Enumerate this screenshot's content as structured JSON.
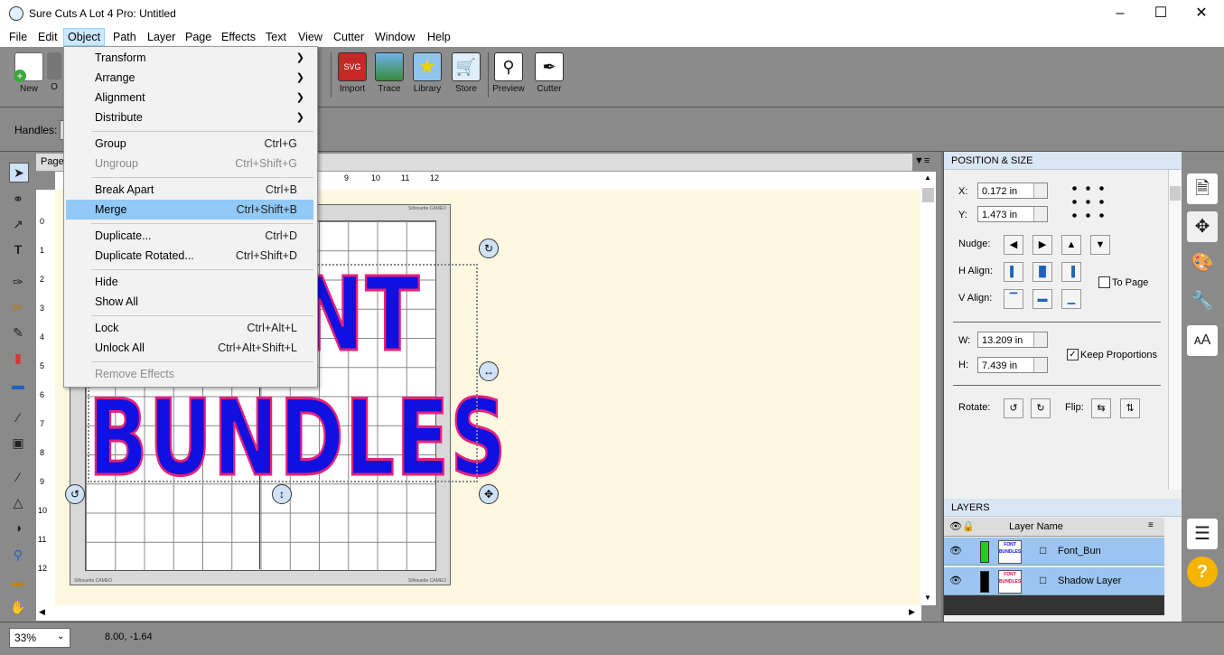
{
  "title": "Sure Cuts A Lot 4 Pro: Untitled",
  "menubar": [
    "File",
    "Edit",
    "Object",
    "Path",
    "Layer",
    "Page",
    "Effects",
    "Text",
    "View",
    "Cutter",
    "Window",
    "Help"
  ],
  "toolbar": {
    "new": "New",
    "import": "Import",
    "trace": "Trace",
    "library": "Library",
    "store": "Store",
    "preview": "Preview",
    "cutter": "Cutter",
    "partial": "O"
  },
  "handles_label": "Handles:",
  "page_tab": "Page",
  "ruler_top": [
    "9",
    "10",
    "11",
    "12"
  ],
  "ruler_left": [
    "0",
    "1",
    "2",
    "3",
    "4",
    "5",
    "6",
    "7",
    "8",
    "9",
    "10",
    "11",
    "12"
  ],
  "canvas_text": {
    "line1": "NT",
    "line2": "BUNDLES"
  },
  "object_menu": [
    {
      "label": "Transform",
      "shortcut": "",
      "submenu": true,
      "disabled": false
    },
    {
      "label": "Arrange",
      "shortcut": "",
      "submenu": true,
      "disabled": false
    },
    {
      "label": "Alignment",
      "shortcut": "",
      "submenu": true,
      "disabled": false
    },
    {
      "label": "Distribute",
      "shortcut": "",
      "submenu": true,
      "disabled": false
    },
    {
      "label": "Group",
      "shortcut": "Ctrl+G",
      "submenu": false,
      "disabled": false
    },
    {
      "label": "Ungroup",
      "shortcut": "Ctrl+Shift+G",
      "submenu": false,
      "disabled": true
    },
    {
      "label": "Break Apart",
      "shortcut": "Ctrl+B",
      "submenu": false,
      "disabled": false
    },
    {
      "label": "Merge",
      "shortcut": "Ctrl+Shift+B",
      "submenu": false,
      "disabled": false,
      "highlighted": true
    },
    {
      "label": "Duplicate...",
      "shortcut": "Ctrl+D",
      "submenu": false,
      "disabled": false
    },
    {
      "label": "Duplicate Rotated...",
      "shortcut": "Ctrl+Shift+D",
      "submenu": false,
      "disabled": false
    },
    {
      "label": "Hide",
      "shortcut": "",
      "submenu": false,
      "disabled": false
    },
    {
      "label": "Show All",
      "shortcut": "",
      "submenu": false,
      "disabled": false
    },
    {
      "label": "Lock",
      "shortcut": "Ctrl+Alt+L",
      "submenu": false,
      "disabled": false
    },
    {
      "label": "Unlock All",
      "shortcut": "Ctrl+Alt+Shift+L",
      "submenu": false,
      "disabled": false
    },
    {
      "label": "Remove Effects",
      "shortcut": "",
      "submenu": false,
      "disabled": true
    }
  ],
  "position_size": {
    "header": "POSITION & SIZE",
    "x_label": "X:",
    "x_value": "0.172 in",
    "y_label": "Y:",
    "y_value": "1.473 in",
    "nudge_label": "Nudge:",
    "halign_label": "H Align:",
    "valign_label": "V Align:",
    "to_page": "To Page",
    "w_label": "W:",
    "w_value": "13.209 in",
    "h_label": "H:",
    "h_value": "7.439 in",
    "keep_proportions": "Keep Proportions",
    "rotate_label": "Rotate:",
    "flip_label": "Flip:"
  },
  "layers": {
    "header": "LAYERS",
    "column": "Layer Name",
    "rows": [
      {
        "name": "Font_Bun",
        "color": "#22cc22",
        "thumb": "FONT BUNDLES"
      },
      {
        "name": "Shadow Layer",
        "color": "#000000",
        "thumb": "FONT BUNDLES"
      }
    ]
  },
  "status": {
    "zoom": "33%",
    "coords": "8.00, -1.64"
  },
  "watermarks": {
    "mat_tr": "Silhouette CAMEO",
    "mat_bl": "Silhouette CAMEO",
    "mat_br": "Silhouette CAMEO"
  }
}
